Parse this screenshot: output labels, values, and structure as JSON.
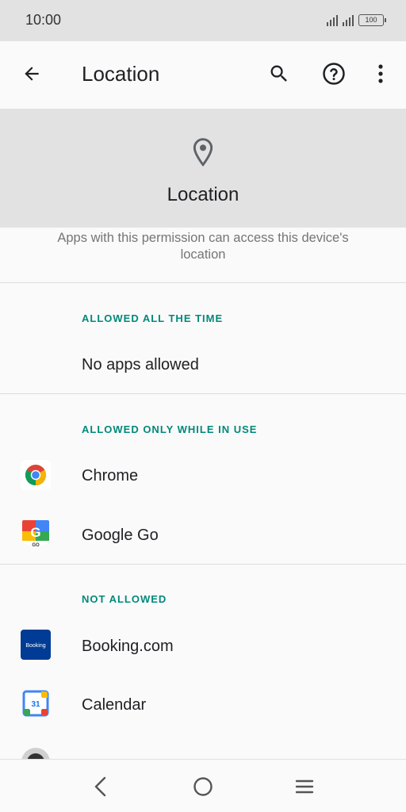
{
  "status_bar": {
    "time": "10:00",
    "battery": "100"
  },
  "app_bar": {
    "title": "Location"
  },
  "header": {
    "title": "Location",
    "description": "Apps with this permission can access this device's location"
  },
  "sections": {
    "allowed_all_time": {
      "label": "ALLOWED ALL THE TIME",
      "empty_text": "No apps allowed"
    },
    "allowed_while_in_use": {
      "label": "ALLOWED ONLY WHILE IN USE",
      "apps": [
        "Chrome",
        "Google Go"
      ]
    },
    "not_allowed": {
      "label": "NOT ALLOWED",
      "apps": [
        "Booking.com",
        "Calendar"
      ]
    }
  },
  "icons": {
    "booking_text": "Booking",
    "calendar_day": "31",
    "google_go_text": "GO"
  },
  "colors": {
    "accent": "#00897b",
    "header_bg": "#e2e2e2",
    "status_bg": "#e2e2e2"
  }
}
